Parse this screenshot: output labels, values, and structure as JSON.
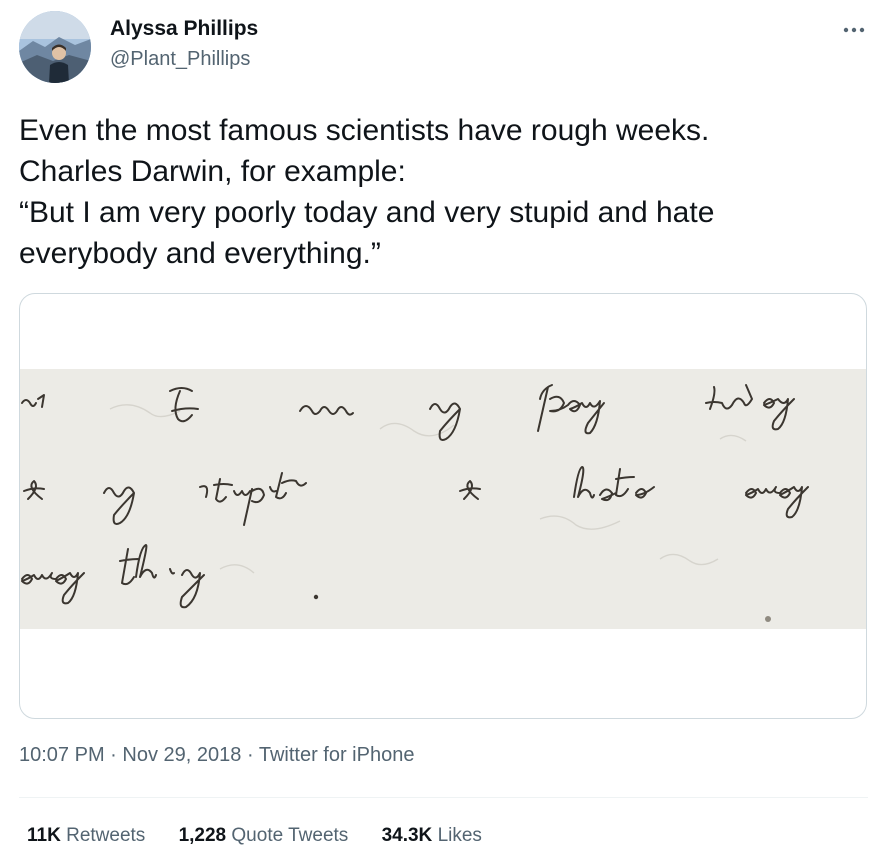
{
  "author": {
    "display_name": "Alyssa Phillips",
    "handle": "@Plant_Phillips",
    "avatar": "profile-photo-mountain"
  },
  "menu": {
    "more_icon": "more-horizontal-icon"
  },
  "tweet": {
    "lines": [
      "Even the most famous scientists have rough weeks.",
      "Charles Darwin, for example:",
      "“But I am very poorly today and very stupid and hate",
      "everybody and everything.”"
    ]
  },
  "media": {
    "handwriting_words": [
      "I",
      "am",
      "very",
      "poorly",
      "today",
      "very",
      "stupid",
      "hate",
      "every",
      "everything"
    ]
  },
  "meta": {
    "time": "10:07 PM",
    "date": "Nov 29, 2018",
    "source": "Twitter for iPhone",
    "separator": "·"
  },
  "stats": {
    "retweets_count": "11K",
    "retweets_label": "Retweets",
    "quotes_count": "1,228",
    "quotes_label": "Quote Tweets",
    "likes_count": "34.3K",
    "likes_label": "Likes"
  },
  "colors": {
    "text_primary": "#0f1419",
    "text_secondary": "#536471",
    "border": "#cfd9de",
    "paper": "#ecebe6",
    "ink": "#3b3630"
  }
}
